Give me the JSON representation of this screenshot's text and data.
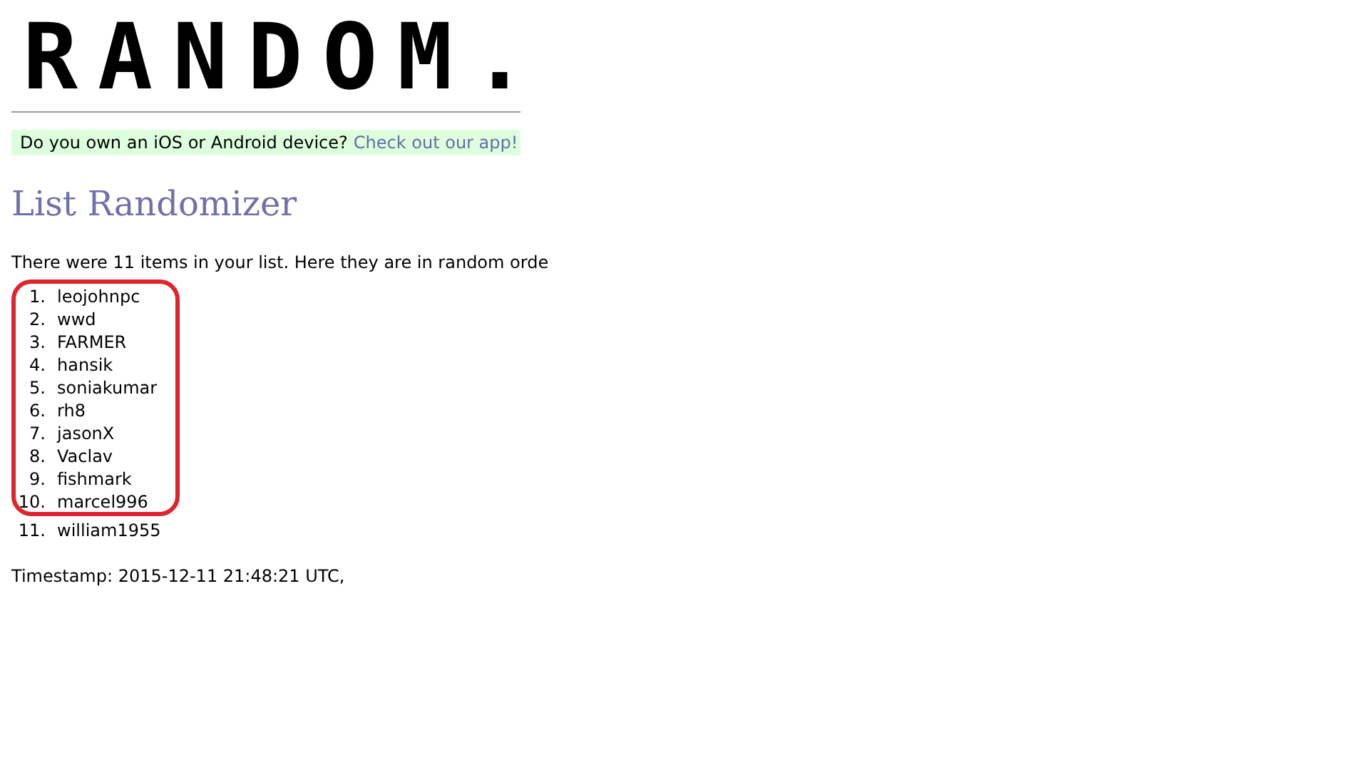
{
  "logo": "RANDOM.",
  "banner": {
    "text": "Do you own an iOS or Android device?",
    "link": "Check out our app!"
  },
  "heading": "List Randomizer",
  "intro": "There were 11 items in your list. Here they are in random orde",
  "items": [
    {
      "number": "1.",
      "text": "leojohnpc"
    },
    {
      "number": "2.",
      "text": "wwd"
    },
    {
      "number": "3.",
      "text": "FARMER"
    },
    {
      "number": "4.",
      "text": "hansik"
    },
    {
      "number": "5.",
      "text": "soniakumar"
    },
    {
      "number": "6.",
      "text": "rh8"
    },
    {
      "number": "7.",
      "text": "jasonX"
    },
    {
      "number": "8.",
      "text": "Vaclav"
    },
    {
      "number": "9.",
      "text": "fishmark"
    },
    {
      "number": "10.",
      "text": "marcel996"
    },
    {
      "number": "11.",
      "text": "william1955"
    }
  ],
  "timestamp": "Timestamp: 2015-12-11 21:48:21 UTC,"
}
